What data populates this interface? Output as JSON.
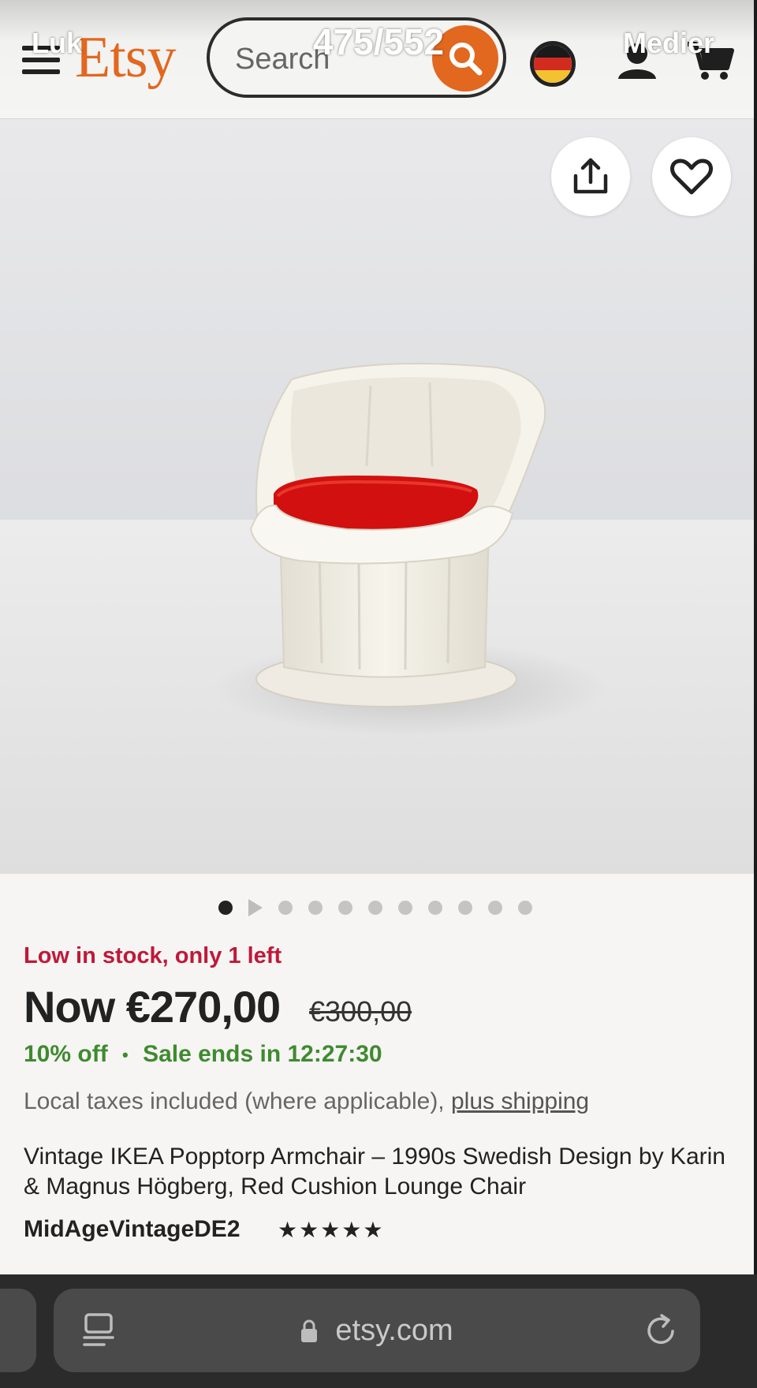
{
  "overlay": {
    "close_label": "Luk",
    "counter": "475/552",
    "media_label": "Medier"
  },
  "header": {
    "logo": "Etsy",
    "search_placeholder": "Search",
    "icons": [
      "menu-icon",
      "search-icon",
      "germany-flag-icon",
      "user-icon",
      "cart-icon"
    ],
    "flag_colors": [
      "#1a1a1a",
      "#d22b1f",
      "#f2c230"
    ]
  },
  "product_image": {
    "icons": [
      "share-icon",
      "heart-icon"
    ],
    "carousel": {
      "total": 11,
      "active_index": 0,
      "second_is_video": true
    }
  },
  "listing": {
    "stock_notice": "Low in stock, only 1 left",
    "price_now": "Now €270,00",
    "price_original": "€300,00",
    "discount": "10% off",
    "sale_separator": "•",
    "sale_ends": "Sale ends in 12:27:30",
    "taxes_text": "Local taxes included (where applicable), ",
    "shipping_link": "plus shipping",
    "title": "Vintage IKEA Popptorp Armchair – 1990s Swedish Design by Karin & Magnus Högberg, Red Cushion Lounge Chair",
    "shop_name": "MidAgeVintageDE2",
    "rating_stars": "★★★★★",
    "rating": 5
  },
  "browser": {
    "url": "etsy.com",
    "icons": [
      "reader-icon",
      "lock-icon",
      "reload-icon"
    ]
  },
  "colors": {
    "brand": "#e2671f",
    "stock_red": "#c0183a",
    "sale_green": "#3f8a30",
    "cushion_red": "#d2100f"
  }
}
